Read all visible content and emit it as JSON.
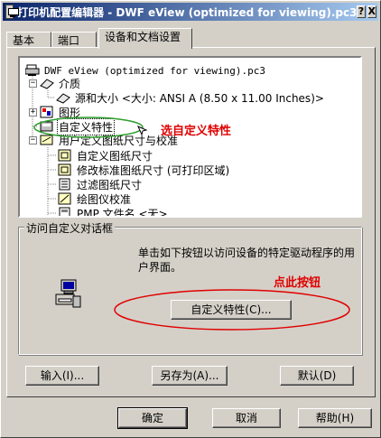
{
  "window": {
    "title": "打印机配置编辑器 - DWF eView (optimized for viewing).pc3",
    "help_btn": "?",
    "close_btn": "X"
  },
  "tabs": [
    {
      "label": "基本"
    },
    {
      "label": "端口"
    },
    {
      "label": "设备和文档设置"
    }
  ],
  "tree": {
    "root": "DWF eView (optimized for viewing).pc3",
    "media": "介质",
    "source_size": "源和大小 <大小: ANSI A (8.50 x 11.00 Inches)>",
    "graphics": "图形",
    "custom_props": "自定义特性",
    "custom_sizes": "用户定义图纸尺寸与校准",
    "custom_paper": "自定义图纸尺寸",
    "modify_paper": "修改标准图纸尺寸 (可打印区域)",
    "filter_paper": "过滤图纸尺寸",
    "plotter_calib": "绘图仪校准",
    "pmp_file": "PMP 文件名 <无>"
  },
  "annotations": {
    "select_custom": "选自定义特性",
    "click_button": "点此按钮",
    "annot_color": "#e00000",
    "circle_green": "#2e9e2e",
    "circle_red": "#e00000"
  },
  "group": {
    "title": "访问自定义对话框",
    "description": "单击如下按钮以访问设备的特定驱动程序的用户界面。",
    "custom_btn": "自定义特性(C)..."
  },
  "panel_buttons": {
    "import": "输入(I)...",
    "save_as": "另存为(A)...",
    "defaults": "默认(D)"
  },
  "footer": {
    "ok": "确定",
    "cancel": "取消",
    "help": "帮助(H)"
  }
}
